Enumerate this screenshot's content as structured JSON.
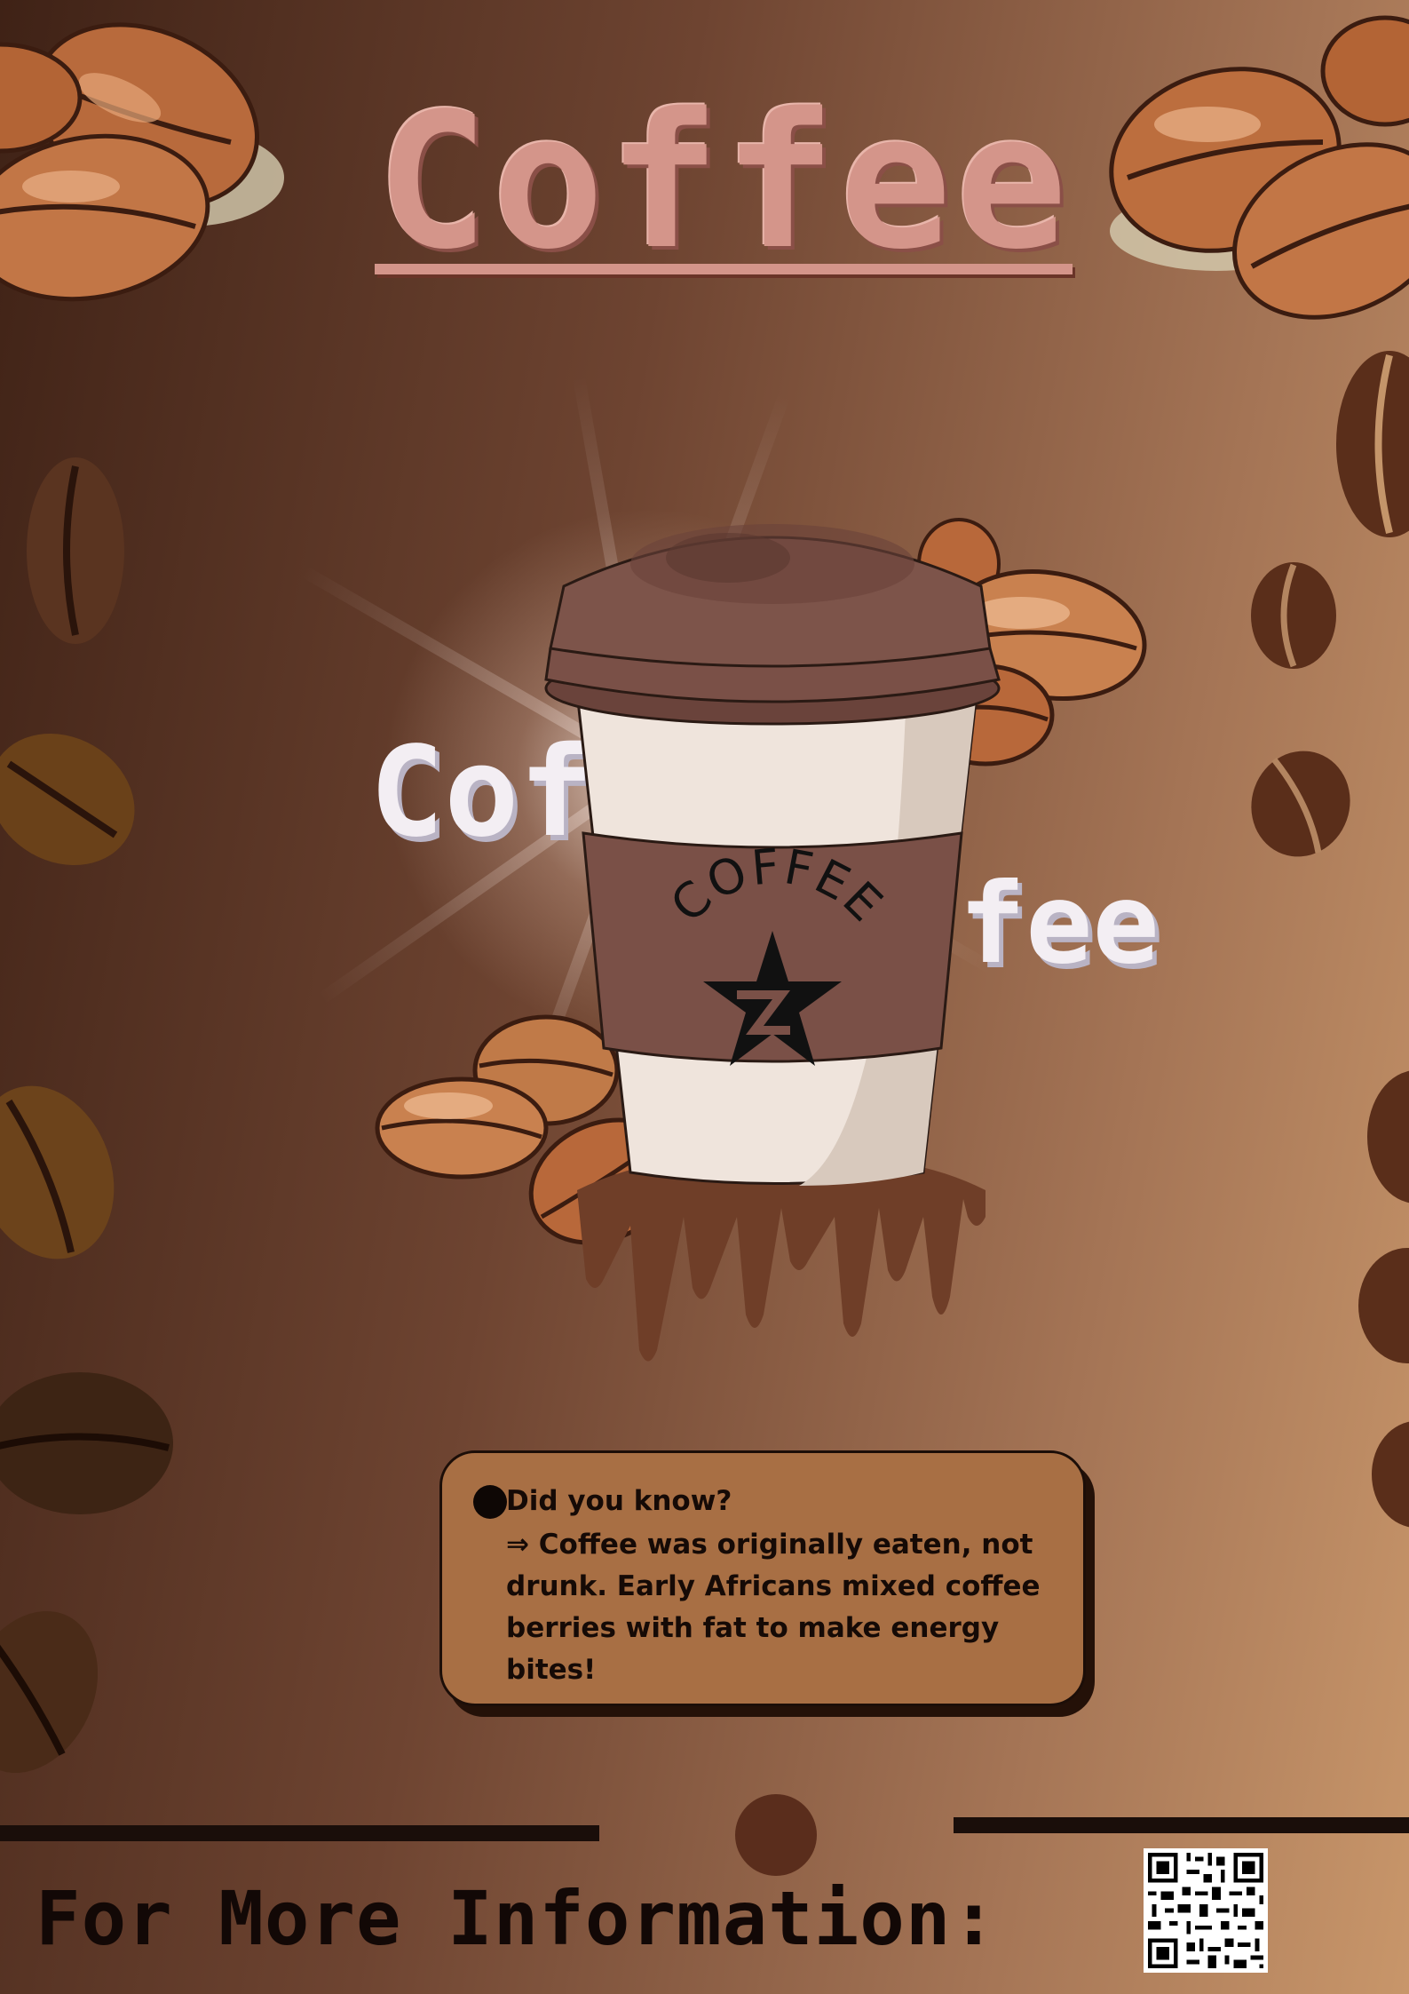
{
  "poster": {
    "title": "Coffee",
    "split_word_left": "Cof",
    "split_word_right": "fee",
    "cup_sleeve_text": "COFFEE",
    "fact": {
      "heading": "Did you know?",
      "text": "⇒ Coffee was originally eaten, not drunk. Early Africans mixed coffee berries with fat to make energy bites!"
    },
    "footer": "For More Information:"
  },
  "colors": {
    "title": "#d4958a",
    "background_dark": "#3f2216",
    "background_light": "#c8966a",
    "fact_box": "#a86f44",
    "cup_body": "#efe4dc",
    "cup_lid": "#7a5047",
    "cup_sleeve": "#7a5047"
  },
  "icons": {
    "cup_logo": "star-logo-icon",
    "qr": "qr-code-icon",
    "beans": "coffee-bean-icon"
  }
}
